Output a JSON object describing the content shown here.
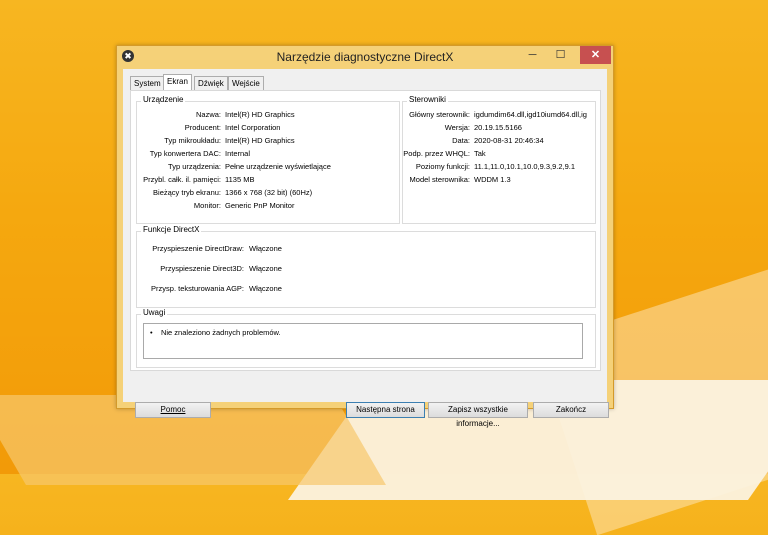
{
  "window": {
    "title": "Narzędzie diagnostyczne DirectX",
    "icon_symbol": "✖",
    "min_glyph": "─",
    "max_glyph": "☐",
    "close_glyph": "✕"
  },
  "tabs": [
    "System",
    "Ekran",
    "Dźwięk",
    "Wejście"
  ],
  "active_tab": "Ekran",
  "device": {
    "title": "Urządzenie",
    "rows": [
      {
        "label": "Nazwa:",
        "value": "Intel(R) HD Graphics"
      },
      {
        "label": "Producent:",
        "value": "Intel Corporation"
      },
      {
        "label": "Typ mikroukładu:",
        "value": "Intel(R) HD Graphics"
      },
      {
        "label": "Typ konwertera DAC:",
        "value": "Internal"
      },
      {
        "label": "Typ urządzenia:",
        "value": "Pełne urządzenie wyświetlające"
      },
      {
        "label": "Przybl. całk. il. pamięci:",
        "value": "1135 MB"
      },
      {
        "label": "Bieżący tryb ekranu:",
        "value": "1366 x 768 (32 bit) (60Hz)"
      },
      {
        "label": "Monitor:",
        "value": "Generic PnP Monitor"
      }
    ]
  },
  "drivers": {
    "title": "Sterowniki",
    "rows": [
      {
        "label": "Główny sterownik:",
        "value": "igdumdim64.dll,igd10iumd64.dll,ig"
      },
      {
        "label": "Wersja:",
        "value": "20.19.15.5166"
      },
      {
        "label": "Data:",
        "value": "2020-08-31 20:46:34"
      },
      {
        "label": "Podp. przez WHQL:",
        "value": "Tak"
      },
      {
        "label": "Poziomy funkcji:",
        "value": "11.1,11.0,10.1,10.0,9.3,9.2,9.1"
      },
      {
        "label": "Model sterownika:",
        "value": "WDDM 1.3"
      }
    ]
  },
  "directx": {
    "title": "Funkcje DirectX",
    "rows": [
      {
        "label": "Przyspieszenie DirectDraw:",
        "value": "Włączone"
      },
      {
        "label": "Przyspieszenie Direct3D:",
        "value": "Włączone"
      },
      {
        "label": "Przysp. teksturowania AGP:",
        "value": "Włączone"
      }
    ]
  },
  "notes": {
    "title": "Uwagi",
    "items": [
      "Nie znaleziono żadnych problemów."
    ]
  },
  "buttons": {
    "help": "Pomoc",
    "next": "Następna strona",
    "save": "Zapisz wszystkie informacje...",
    "exit": "Zakończ"
  }
}
